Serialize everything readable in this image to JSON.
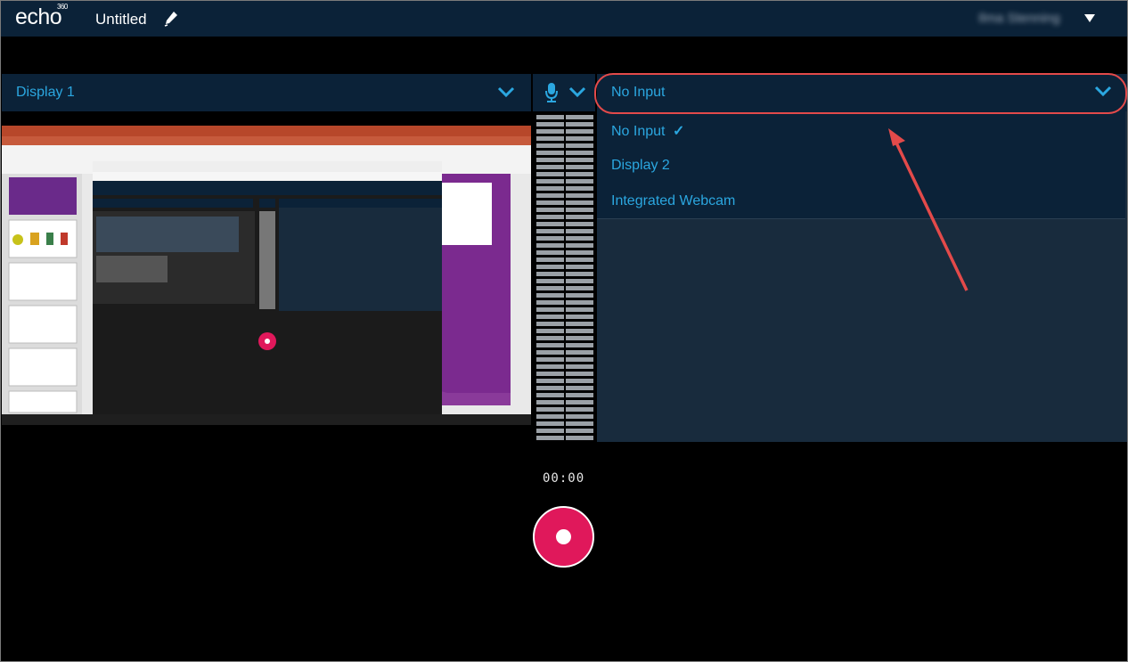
{
  "app": {
    "logo": "echo",
    "logo_super": "360",
    "title": "Untitled",
    "user": "Ilma Stenning"
  },
  "sources": {
    "primary": {
      "label": "Display 1"
    },
    "secondary": {
      "label": "No Input"
    }
  },
  "dropdown": {
    "items": [
      {
        "label": "No Input",
        "selected": true,
        "check": "✓"
      },
      {
        "label": "Display 2",
        "selected": false
      },
      {
        "label": "Integrated Webcam",
        "selected": false
      }
    ]
  },
  "recording": {
    "timer": "00:00"
  },
  "colors": {
    "topbar": "#0b2238",
    "accent": "#2ba7e0",
    "record": "#e0185b",
    "highlight": "#e34a4a",
    "panel": "#182b3d"
  }
}
